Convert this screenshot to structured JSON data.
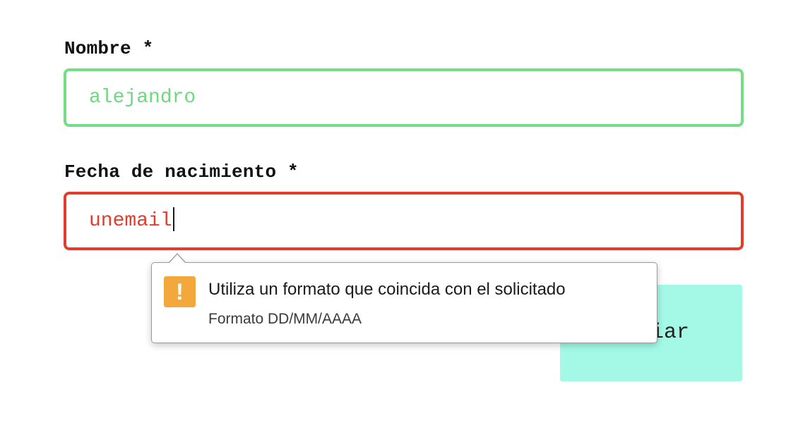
{
  "form": {
    "name_label": "Nombre *",
    "name_value": "alejandro",
    "birthdate_label": "Fecha de nacimiento *",
    "birthdate_value": "unemail",
    "submit_label": "Enviar"
  },
  "validation_tooltip": {
    "icon": "warning-icon",
    "icon_glyph": "!",
    "title": "Utiliza un formato que coincida con el solicitado",
    "hint": "Formato DD/MM/AAAA"
  },
  "colors": {
    "valid_border": "#74de85",
    "invalid_border": "#e23d2c",
    "submit_background": "#a3f9e6",
    "warning_icon": "#f3a83b"
  }
}
